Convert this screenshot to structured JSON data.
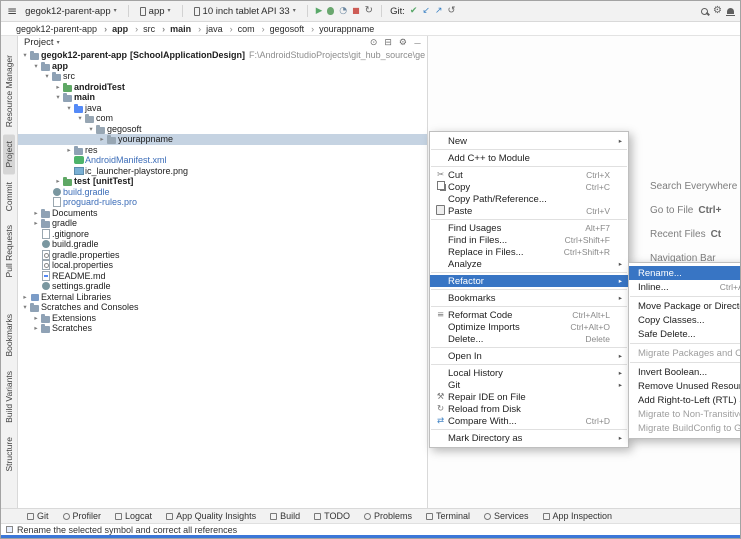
{
  "colors": {
    "selection_blue": "#3875c4",
    "tree_selection": "#c5d3e2",
    "status_strip_blue": "#3b77d8"
  },
  "toolbar": {
    "project_button": "gegok12-parent-app",
    "run_config": "app",
    "device": "10 inch tablet API 33",
    "git_label": "Git:"
  },
  "breadcrumbs": [
    {
      "label": "gegok12-parent-app",
      "cls": ""
    },
    {
      "label": "app",
      "cls": "bold"
    },
    {
      "label": "src",
      "cls": ""
    },
    {
      "label": "main",
      "cls": "bold"
    },
    {
      "label": "java",
      "cls": ""
    },
    {
      "label": "com",
      "cls": ""
    },
    {
      "label": "gegosoft",
      "cls": ""
    },
    {
      "label": "yourappname",
      "cls": ""
    }
  ],
  "left_tabs_top": [
    {
      "label": "Resource Manager",
      "cls": ""
    },
    {
      "label": "Project",
      "cls": "active"
    },
    {
      "label": "Commit",
      "cls": ""
    },
    {
      "label": "Pull Requests",
      "cls": ""
    }
  ],
  "left_tabs_bottom": [
    {
      "label": "Bookmarks",
      "cls": ""
    },
    {
      "label": "Build Variants",
      "cls": ""
    },
    {
      "label": "Structure",
      "cls": ""
    }
  ],
  "project_panel": {
    "title": "Project",
    "header_icons": [
      {
        "icon": "locate-icon"
      },
      {
        "icon": "collapse-all-icon"
      },
      {
        "icon": "panel-settings-icon"
      },
      {
        "icon": "hide-icon"
      }
    ],
    "tree": [
      {
        "pad": 3,
        "chev": "▾",
        "icon": "ic-folder",
        "cls": "bold",
        "label": "gegok12-parent-app",
        "suffix": "[SchoolApplicationDesign]",
        "path": "F:\\AndroidStudioProjects\\git_hub_source\\ge"
      },
      {
        "pad": 14,
        "chev": "▾",
        "icon": "ic-folder",
        "cls": "bold",
        "label": "app",
        "suffix": "",
        "path": ""
      },
      {
        "pad": 25,
        "chev": "▾",
        "icon": "ic-folder",
        "cls": "",
        "label": "src",
        "suffix": "",
        "path": ""
      },
      {
        "pad": 36,
        "chev": "▸",
        "icon": "ic-folder ic-green",
        "cls": "bold",
        "label": "androidTest",
        "suffix": "",
        "path": ""
      },
      {
        "pad": 36,
        "chev": "▾",
        "icon": "ic-folder",
        "cls": "bold",
        "label": "main",
        "suffix": "",
        "path": ""
      },
      {
        "pad": 47,
        "chev": "▾",
        "icon": "ic-folder ic-blue",
        "cls": "",
        "label": "java",
        "suffix": "",
        "path": ""
      },
      {
        "pad": 58,
        "chev": "▾",
        "icon": "ic-pkg",
        "cls": "",
        "label": "com",
        "suffix": "",
        "path": ""
      },
      {
        "pad": 69,
        "chev": "▾",
        "icon": "ic-pkg",
        "cls": "",
        "label": "gegosoft",
        "suffix": "",
        "path": ""
      },
      {
        "pad": 80,
        "chev": "▸",
        "icon": "ic-pkg",
        "cls": "selected",
        "label": "yourappname",
        "suffix": "",
        "path": ""
      },
      {
        "pad": 47,
        "chev": "▸",
        "icon": "ic-folder",
        "cls": "",
        "label": "res",
        "suffix": "",
        "path": ""
      },
      {
        "pad": 47,
        "chev": "",
        "icon": "ic-android",
        "cls": "bluef",
        "label": "AndroidManifest.xml",
        "suffix": "",
        "path": ""
      },
      {
        "pad": 47,
        "chev": "",
        "icon": "ic-image",
        "cls": "",
        "label": "ic_launcher-playstore.png",
        "suffix": "",
        "path": ""
      },
      {
        "pad": 36,
        "chev": "▸",
        "icon": "ic-folder ic-green",
        "cls": "bold",
        "label": "test",
        "suffix": "[unitTest]",
        "path": ""
      },
      {
        "pad": 25,
        "chev": "",
        "icon": "ic-gradle",
        "cls": "bluef",
        "label": "build.gradle",
        "suffix": "",
        "path": ""
      },
      {
        "pad": 25,
        "chev": "",
        "icon": "ic-file",
        "cls": "bluef",
        "label": "proguard-rules.pro",
        "suffix": "",
        "path": ""
      },
      {
        "pad": 14,
        "chev": "▸",
        "icon": "ic-folder",
        "cls": "",
        "label": "Documents",
        "suffix": "",
        "path": ""
      },
      {
        "pad": 14,
        "chev": "▸",
        "icon": "ic-folder",
        "cls": "",
        "label": "gradle",
        "suffix": "",
        "path": ""
      },
      {
        "pad": 14,
        "chev": "",
        "icon": "ic-file",
        "cls": "",
        "label": ".gitignore",
        "suffix": "",
        "path": ""
      },
      {
        "pad": 14,
        "chev": "",
        "icon": "ic-gradle",
        "cls": "",
        "label": "build.gradle",
        "suffix": "",
        "path": ""
      },
      {
        "pad": 14,
        "chev": "",
        "icon": "ic-props",
        "cls": "",
        "label": "gradle.properties",
        "suffix": "",
        "path": ""
      },
      {
        "pad": 14,
        "chev": "",
        "icon": "ic-props",
        "cls": "",
        "label": "local.properties",
        "suffix": "",
        "path": ""
      },
      {
        "pad": 14,
        "chev": "",
        "icon": "ic-md",
        "cls": "",
        "label": "README.md",
        "suffix": "",
        "path": ""
      },
      {
        "pad": 14,
        "chev": "",
        "icon": "ic-gradle",
        "cls": "",
        "label": "settings.gradle",
        "suffix": "",
        "path": ""
      },
      {
        "pad": 3,
        "chev": "▸",
        "icon": "ic-lib",
        "cls": "",
        "label": "External Libraries",
        "suffix": "",
        "path": ""
      },
      {
        "pad": 3,
        "chev": "▾",
        "icon": "ic-folder",
        "cls": "",
        "label": "Scratches and Consoles",
        "suffix": "",
        "path": ""
      },
      {
        "pad": 14,
        "chev": "▸",
        "icon": "ic-folder",
        "cls": "",
        "label": "Extensions",
        "suffix": "",
        "path": ""
      },
      {
        "pad": 14,
        "chev": "▸",
        "icon": "ic-folder",
        "cls": "",
        "label": "Scratches",
        "suffix": "",
        "path": ""
      }
    ]
  },
  "editor_hints": [
    {
      "label": "Search Everywhere",
      "shortcut": ""
    },
    {
      "label": "Go to File",
      "shortcut": "Ctrl+"
    },
    {
      "label": "Recent Files",
      "shortcut": "Ct"
    },
    {
      "label": "Navigation Bar",
      "shortcut": ""
    }
  ],
  "context_menu": {
    "items": [
      {
        "icon": "",
        "label": "New",
        "shortcut": "",
        "arrow": "▸",
        "cls": ""
      },
      {
        "cls": "sep"
      },
      {
        "icon": "",
        "label": "Add C++ to Module",
        "shortcut": "",
        "arrow": "",
        "cls": ""
      },
      {
        "cls": "sep"
      },
      {
        "icon": "cut-icon",
        "label": "Cut",
        "shortcut": "Ctrl+X",
        "arrow": "",
        "cls": ""
      },
      {
        "icon": "copy-icon",
        "label": "Copy",
        "shortcut": "Ctrl+C",
        "arrow": "",
        "cls": ""
      },
      {
        "icon": "",
        "label": "Copy Path/Reference...",
        "shortcut": "",
        "arrow": "",
        "cls": ""
      },
      {
        "icon": "paste-icon",
        "label": "Paste",
        "shortcut": "Ctrl+V",
        "arrow": "",
        "cls": ""
      },
      {
        "cls": "sep"
      },
      {
        "icon": "",
        "label": "Find Usages",
        "shortcut": "Alt+F7",
        "arrow": "",
        "cls": ""
      },
      {
        "icon": "",
        "label": "Find in Files...",
        "shortcut": "Ctrl+Shift+F",
        "arrow": "",
        "cls": ""
      },
      {
        "icon": "",
        "label": "Replace in Files...",
        "shortcut": "Ctrl+Shift+R",
        "arrow": "",
        "cls": ""
      },
      {
        "icon": "",
        "label": "Analyze",
        "shortcut": "",
        "arrow": "▸",
        "cls": ""
      },
      {
        "cls": "sep"
      },
      {
        "icon": "",
        "label": "Refactor",
        "shortcut": "",
        "arrow": "▸",
        "cls": "hl"
      },
      {
        "cls": "sep"
      },
      {
        "icon": "",
        "label": "Bookmarks",
        "shortcut": "",
        "arrow": "▸",
        "cls": ""
      },
      {
        "cls": "sep"
      },
      {
        "icon": "reformat-icon",
        "label": "Reformat Code",
        "shortcut": "Ctrl+Alt+L",
        "arrow": "",
        "cls": ""
      },
      {
        "icon": "",
        "label": "Optimize Imports",
        "shortcut": "Ctrl+Alt+O",
        "arrow": "",
        "cls": ""
      },
      {
        "icon": "",
        "label": "Delete...",
        "shortcut": "Delete",
        "arrow": "",
        "cls": ""
      },
      {
        "cls": "sep"
      },
      {
        "icon": "",
        "label": "Open In",
        "shortcut": "",
        "arrow": "▸",
        "cls": ""
      },
      {
        "cls": "sep"
      },
      {
        "icon": "",
        "label": "Local History",
        "shortcut": "",
        "arrow": "▸",
        "cls": ""
      },
      {
        "icon": "",
        "label": "Git",
        "shortcut": "",
        "arrow": "▸",
        "cls": ""
      },
      {
        "icon": "repair-icon",
        "label": "Repair IDE on File",
        "shortcut": "",
        "arrow": "",
        "cls": ""
      },
      {
        "icon": "reload-icon",
        "label": "Reload from Disk",
        "shortcut": "",
        "arrow": "",
        "cls": ""
      },
      {
        "icon": "compare-icon",
        "label": "Compare With...",
        "shortcut": "Ctrl+D",
        "arrow": "",
        "cls": ""
      },
      {
        "cls": "sep"
      },
      {
        "icon": "",
        "label": "Mark Directory as",
        "shortcut": "",
        "arrow": "▸",
        "cls": ""
      }
    ]
  },
  "refactor_submenu": {
    "items": [
      {
        "icon": "",
        "label": "Rename...",
        "shortcut": "",
        "arrow": "",
        "cls": "hl"
      },
      {
        "icon": "",
        "label": "Inline...",
        "shortcut": "Ctrl+Alt+N",
        "arrow": "",
        "cls": ""
      },
      {
        "cls": "sep"
      },
      {
        "icon": "",
        "label": "Move Package or Directory...",
        "shortcut": "",
        "arrow": "",
        "cls": ""
      },
      {
        "icon": "",
        "label": "Copy Classes...",
        "shortcut": "",
        "arrow": "",
        "cls": ""
      },
      {
        "icon": "",
        "label": "Safe Delete...",
        "shortcut": "",
        "arrow": "",
        "cls": ""
      },
      {
        "cls": "sep"
      },
      {
        "icon": "",
        "label": "Migrate Packages and Classes",
        "shortcut": "",
        "arrow": "",
        "cls": "dis"
      },
      {
        "cls": "sep"
      },
      {
        "icon": "",
        "label": "Invert Boolean...",
        "shortcut": "",
        "arrow": "",
        "cls": ""
      },
      {
        "icon": "",
        "label": "Remove Unused Resources...",
        "shortcut": "",
        "arrow": "",
        "cls": ""
      },
      {
        "icon": "",
        "label": "Add Right-to-Left (RTL) Support...",
        "shortcut": "",
        "arrow": "",
        "cls": ""
      },
      {
        "icon": "",
        "label": "Migrate to Non-Transitive R Classes",
        "shortcut": "",
        "arrow": "",
        "cls": "dis"
      },
      {
        "icon": "",
        "label": "Migrate BuildConfig to Gradle Build",
        "shortcut": "",
        "arrow": "",
        "cls": "dis"
      }
    ]
  },
  "bottom_bar": [
    {
      "label": "Git",
      "icon": "git-status-icon"
    },
    {
      "label": "Profiler",
      "icon": "profiler-icon"
    },
    {
      "label": "Logcat",
      "icon": "logcat-icon"
    },
    {
      "label": "App Quality Insights",
      "icon": "app-quality-insights-icon"
    },
    {
      "label": "Build",
      "icon": "build-icon"
    },
    {
      "label": "TODO",
      "icon": "todo-icon"
    },
    {
      "label": "Problems",
      "icon": "problems-icon"
    },
    {
      "label": "Terminal",
      "icon": "terminal-icon"
    },
    {
      "label": "Services",
      "icon": "services-icon"
    },
    {
      "label": "App Inspection",
      "icon": "app-inspection-icon"
    }
  ],
  "status_bar": {
    "text": "Rename the selected symbol and correct all references"
  }
}
